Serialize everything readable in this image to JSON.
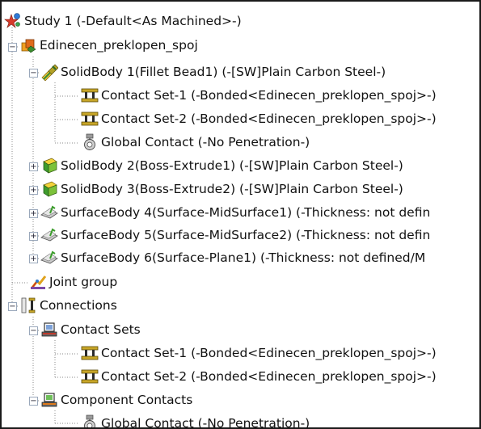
{
  "tree": {
    "root_label": "Study 1 (-Default<As Machined>-)",
    "part_label": "Edinecen_preklopen_spoj",
    "solidbody1": {
      "label": "SolidBody 1(Fillet Bead1) (-[SW]Plain Carbon Steel-)",
      "children": [
        "Contact Set-1 (-Bonded<Edinecen_preklopen_spoj>-)",
        "Contact Set-2 (-Bonded<Edinecen_preklopen_spoj>-)",
        "Global Contact (-No Penetration-)"
      ]
    },
    "solidbody2_label": "SolidBody 2(Boss-Extrude1) (-[SW]Plain Carbon Steel-)",
    "solidbody3_label": "SolidBody 3(Boss-Extrude2) (-[SW]Plain Carbon Steel-)",
    "surfacebody4_label": "SurfaceBody 4(Surface-MidSurface1) (-Thickness: not defin",
    "surfacebody5_label": "SurfaceBody 5(Surface-MidSurface2) (-Thickness: not defin",
    "surfacebody6_label": "SurfaceBody 6(Surface-Plane1) (-Thickness: not defined/M",
    "joint_group_label": "Joint group",
    "connections_label": "Connections",
    "contact_sets_label": "Contact Sets",
    "contact_sets_children": [
      "Contact Set-1 (-Bonded<Edinecen_preklopen_spoj>-)",
      "Contact Set-2 (-Bonded<Edinecen_preklopen_spoj>-)"
    ],
    "component_contacts_label": "Component Contacts",
    "global_contact_label": "Global Contact (-No Penetration-)",
    "expander_collapsed": "+",
    "expander_expanded": "−"
  }
}
